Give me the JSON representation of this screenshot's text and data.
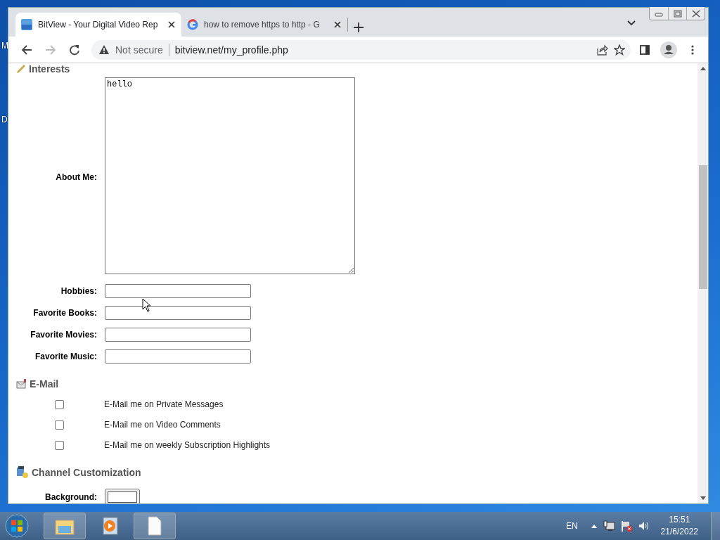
{
  "desktop_letters": [
    "M",
    "D"
  ],
  "browser": {
    "tabs": [
      {
        "title": "BitView - Your Digital Video Rep",
        "selected": true
      },
      {
        "title": "how to remove https to http - G",
        "selected": false
      }
    ],
    "back": {
      "disabled": false
    },
    "forward": {
      "disabled": true
    },
    "address_bar": {
      "security": "Not secure",
      "url": "bitview.net/my_profile.php"
    }
  },
  "profile": {
    "interests_heading": "Interests",
    "about_me": {
      "label": "About Me:",
      "value": "hello"
    },
    "fields": [
      {
        "label": "Hobbies:"
      },
      {
        "label": "Favorite Books:"
      },
      {
        "label": "Favorite Movies:"
      },
      {
        "label": "Favorite Music:"
      }
    ],
    "email_heading": "E-Mail",
    "email_options": [
      {
        "label": "E-Mail me on Private Messages",
        "checked": false
      },
      {
        "label": "E-Mail me on Video Comments",
        "checked": false
      },
      {
        "label": "E-Mail me on weekly Subscription Highlights",
        "checked": false
      }
    ],
    "channel_heading": "Channel Customization",
    "background": {
      "label": "Background:"
    }
  },
  "taskbar": {
    "language": "EN",
    "time": "15:51",
    "date": "21/6/2022"
  }
}
